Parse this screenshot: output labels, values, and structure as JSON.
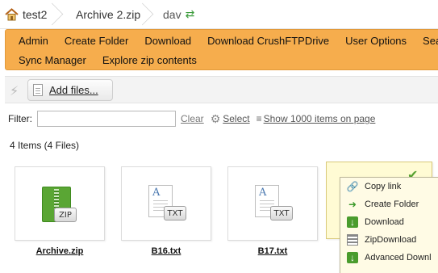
{
  "breadcrumb": {
    "items": [
      "test2",
      "Archive 2.zip",
      "dav"
    ]
  },
  "menu": {
    "row1": [
      "Admin",
      "Create Folder",
      "Download",
      "Download CrushFTPDrive",
      "User Options",
      "Sea"
    ],
    "row2": [
      "Sync Manager",
      "Explore zip contents"
    ]
  },
  "toolbar": {
    "add_files_label": "Add files..."
  },
  "filter": {
    "label": "Filter:",
    "value": "",
    "clear_label": "Clear",
    "select_label": "Select",
    "show_label": "Show 1000 items on page"
  },
  "summary": {
    "count_text": "4 Items (4 Files)"
  },
  "files": [
    {
      "name": "Archive.zip",
      "badge": "ZIP"
    },
    {
      "name": "B16.txt",
      "badge": "TXT"
    },
    {
      "name": "B17.txt",
      "badge": "TXT"
    }
  ],
  "context_menu": {
    "items": [
      "Copy link",
      "Create Folder",
      "Download",
      "ZipDownload",
      "Advanced Downl"
    ]
  },
  "colors": {
    "menu_background": "#f6ad4d",
    "selected_tile": "#fffbd4",
    "context_menu_background": "#fffbe5",
    "accent_green": "#4a9c2d"
  }
}
